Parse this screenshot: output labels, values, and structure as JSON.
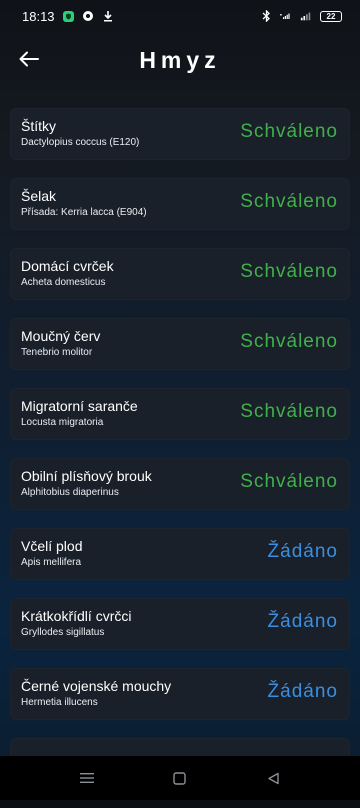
{
  "status_bar": {
    "time": "18:13",
    "battery": "22"
  },
  "header": {
    "title": "Hmyz"
  },
  "items": [
    {
      "title": "Štítky",
      "subtitle": "Dactylopius coccus (E120)",
      "status": "Schváleno",
      "status_type": "approved"
    },
    {
      "title": "Šelak",
      "subtitle": "Přísada: Kerria lacca (E904)",
      "status": "Schváleno",
      "status_type": "approved"
    },
    {
      "title": "Domácí cvrček",
      "subtitle": "Acheta domesticus",
      "status": "Schváleno",
      "status_type": "approved"
    },
    {
      "title": "Moučný červ",
      "subtitle": "Tenebrio molitor",
      "status": "Schváleno",
      "status_type": "approved"
    },
    {
      "title": "Migratorní saranče",
      "subtitle": "Locusta migratoria",
      "status": "Schváleno",
      "status_type": "approved"
    },
    {
      "title": "Obilní plísňový brouk",
      "subtitle": "Alphitobius diaperinus",
      "status": "Schváleno",
      "status_type": "approved"
    },
    {
      "title": "Včelí plod",
      "subtitle": "Apis mellifera",
      "status": "Žádáno",
      "status_type": "requested"
    },
    {
      "title": "Krátkokřídlí cvrčci",
      "subtitle": "Gryllodes sigillatus",
      "status": "Žádáno",
      "status_type": "requested"
    },
    {
      "title": "Černé vojenské mouchy",
      "subtitle": "Hermetia illucens",
      "status": "Žádáno",
      "status_type": "requested"
    }
  ],
  "colors": {
    "approved": "#3fb14a",
    "requested": "#3a8fe0",
    "card": "#1a2029"
  },
  "icons": {
    "back": "arrow-left-icon",
    "nav_recents": "menu-icon",
    "nav_home": "square-icon",
    "nav_back": "triangle-back-icon"
  }
}
